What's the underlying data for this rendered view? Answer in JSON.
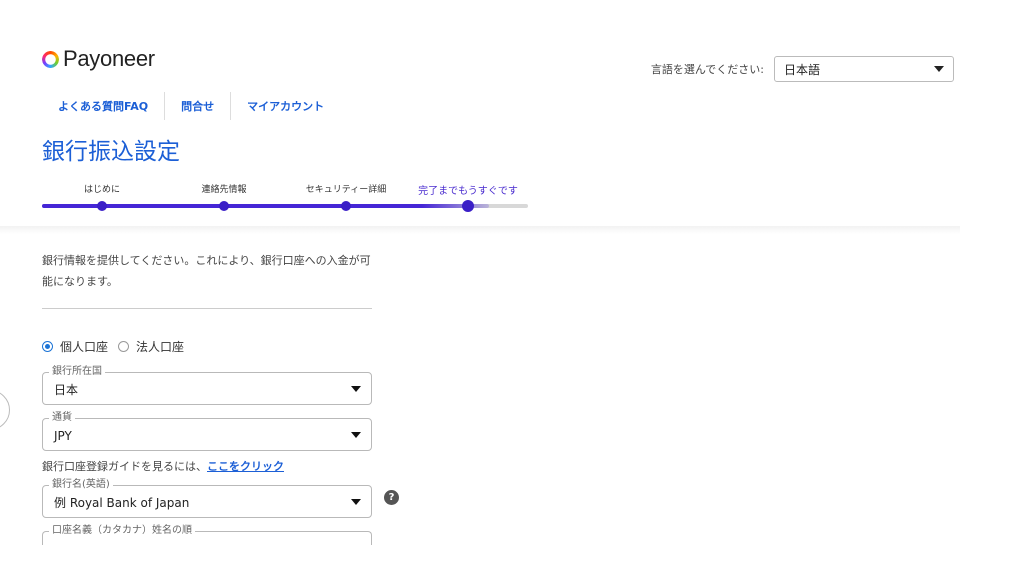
{
  "brand": {
    "name": "Payoneer"
  },
  "language": {
    "label": "言語を選んでください:",
    "selected": "日本語"
  },
  "nav": [
    {
      "label": "よくある質問FAQ"
    },
    {
      "label": "問合せ"
    },
    {
      "label": "マイアカウント"
    }
  ],
  "page_title": "銀行振込設定",
  "progress": {
    "steps": [
      {
        "label": "はじめに"
      },
      {
        "label": "連絡先情報"
      },
      {
        "label": "セキュリティー詳細"
      },
      {
        "label": "完了までもうすぐです"
      }
    ],
    "current_step": 4,
    "fill_fraction": 0.92,
    "accent_color": "#3a1fc7"
  },
  "intro_text": "銀行情報を提供してください。これにより、銀行口座への入金が可能になります。",
  "account_type": {
    "options": [
      {
        "label": "個人口座",
        "checked": true
      },
      {
        "label": "法人口座",
        "checked": false
      }
    ]
  },
  "fields": {
    "bank_country": {
      "label": "銀行所在国",
      "value": "日本"
    },
    "currency": {
      "label": "通貨",
      "value": "JPY"
    },
    "bank_name": {
      "label": "銀行名(英語)",
      "value": "例 Royal Bank of Japan"
    },
    "account_holder": {
      "label": "口座名義（カタカナ）姓名の順"
    }
  },
  "guide": {
    "text": "銀行口座登録ガイドを見るには、",
    "link": "ここをクリック"
  },
  "help_icon": "?"
}
